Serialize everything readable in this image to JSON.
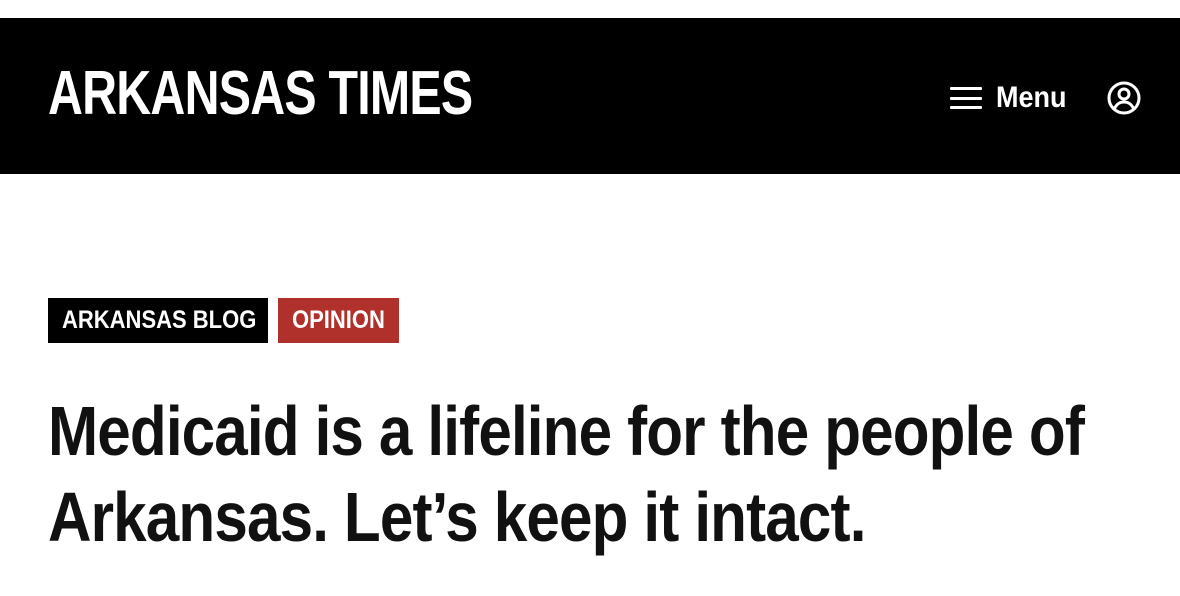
{
  "site": {
    "logo_text": "ARKANSAS TIMES",
    "menu_label": "Menu",
    "menu_icon": "hamburger-icon",
    "account_icon": "user-circle-icon"
  },
  "article": {
    "categories": [
      {
        "label": "ARKANSAS BLOG",
        "color": "#000000"
      },
      {
        "label": "OPINION",
        "color": "#b0302c"
      }
    ],
    "headline_lines": [
      "Medicaid is a lifeline for the people of",
      "Arkansas. Let’s keep it intact."
    ]
  }
}
